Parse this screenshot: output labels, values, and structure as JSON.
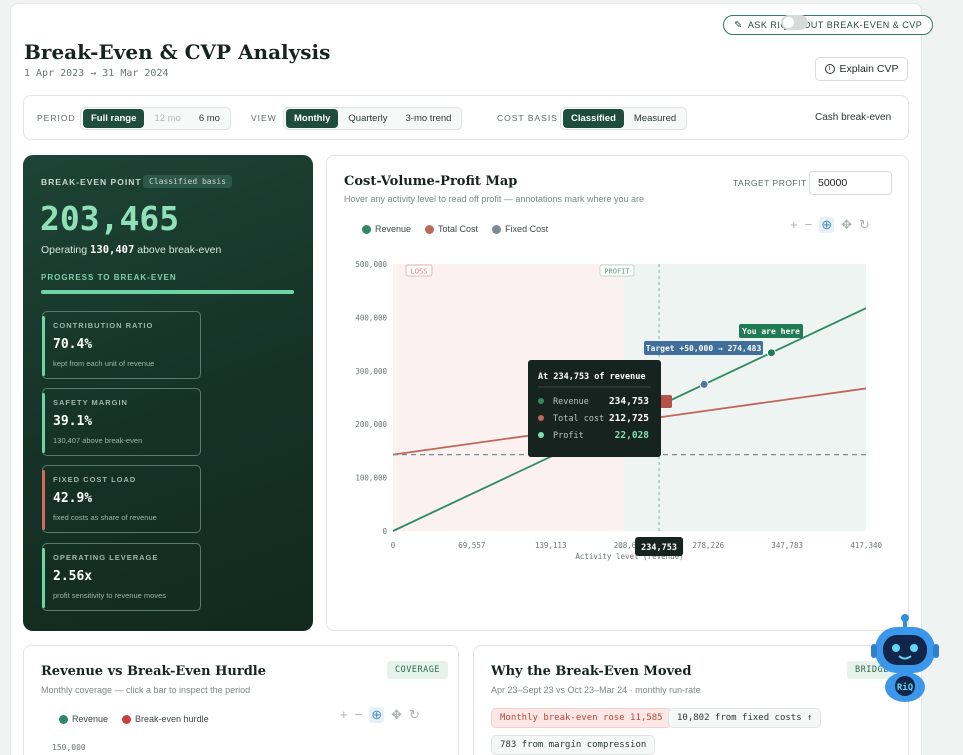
{
  "header": {
    "ask_button": "ASK RIQ ABOUT BREAK-EVEN & CVP",
    "title": "Break-Even & CVP Analysis",
    "date_range": "1 Apr 2023 → 31 Mar 2024",
    "explain_button": "Explain CVP"
  },
  "toolbar": {
    "period_label": "PERIOD",
    "period_options": [
      "Full range",
      "12 mo",
      "6 mo"
    ],
    "view_label": "VIEW",
    "view_options": [
      "Monthly",
      "Quarterly",
      "3-mo trend"
    ],
    "cost_basis_label": "COST BASIS",
    "cost_basis_options": [
      "Classified",
      "Measured"
    ],
    "cash_toggle_label": "Cash break-even",
    "cash_toggle_on": false
  },
  "bep": {
    "heading": "BREAK-EVEN POINT",
    "badge": "Classified basis",
    "value": "203,465",
    "sub_prefix": "Operating",
    "sub_value": "130,407",
    "sub_suffix": "above break-even",
    "progress_label": "PROGRESS TO BREAK-EVEN",
    "progress": 1.0,
    "metrics": [
      {
        "label": "CONTRIBUTION RATIO",
        "value": "70.4%",
        "desc": "kept from each unit of revenue",
        "accent": "#6fd4a2"
      },
      {
        "label": "SAFETY MARGIN",
        "value": "39.1%",
        "desc": "130,407 above break-even",
        "accent": "#6fd4a2"
      },
      {
        "label": "FIXED COST LOAD",
        "value": "42.9%",
        "desc": "fixed costs as share of revenue",
        "accent": "#d06a5d"
      },
      {
        "label": "OPERATING LEVERAGE",
        "value": "2.56x",
        "desc": "profit sensitivity to revenue moves",
        "accent": "#6fd4a2"
      }
    ]
  },
  "cvp": {
    "title": "Cost-Volume-Profit Map",
    "subtitle": "Hover any activity level to read off profit — annotations mark where you are",
    "target_profit_label": "TARGET PROFIT",
    "target_profit_value": "50000",
    "legend": [
      {
        "name": "Revenue",
        "color": "#2f8a63"
      },
      {
        "name": "Total Cost",
        "color": "#c0675a"
      },
      {
        "name": "Fixed Cost",
        "color": "#7c8b93"
      }
    ],
    "tools": [
      "zoom-in-icon",
      "zoom-out-icon",
      "zoom-select-icon",
      "pan-icon",
      "reset-icon"
    ]
  },
  "chart_data": {
    "type": "line",
    "xlabel": "Activity level (revenue)",
    "ylabel": "",
    "xlim": [
      0,
      417340
    ],
    "ylim": [
      0,
      500000
    ],
    "x_ticks": [
      "0",
      "69,557",
      "139,113",
      "208,670",
      "278,226",
      "347,783",
      "417,340"
    ],
    "y_ticks": [
      "0",
      "100,000",
      "200,000",
      "300,000",
      "400,000",
      "500,000"
    ],
    "series": [
      {
        "name": "Revenue",
        "points": [
          [
            0,
            0
          ],
          [
            417340,
            417340
          ]
        ],
        "color": "#2f8a63"
      },
      {
        "name": "Total Cost",
        "points": [
          [
            0,
            143000
          ],
          [
            417340,
            267000
          ]
        ],
        "color": "#c0675a"
      },
      {
        "name": "Fixed Cost",
        "points": [
          [
            0,
            143000
          ],
          [
            417340,
            143000
          ]
        ],
        "color": "#7c8b93"
      }
    ],
    "zones": [
      {
        "label": "LOSS"
      },
      {
        "label": "PROFIT"
      }
    ],
    "break_even_x": 203465,
    "hover_x": 234753,
    "hover_x_label": "234,753",
    "markers": [
      {
        "label": "Target +50,000 → 274,483",
        "x": 274483,
        "y": 274483
      },
      {
        "label": "You are here",
        "x": 333872,
        "y": 333872
      }
    ],
    "tooltip": {
      "title": "At 234,753 of revenue",
      "rows": [
        {
          "name": "Revenue",
          "value": "234,753",
          "color": "#2f8a63"
        },
        {
          "name": "Total cost",
          "value": "212,725",
          "color": "#c0675a"
        },
        {
          "name": "Profit",
          "value": "22,028",
          "color": "#7ee0b0"
        }
      ]
    },
    "grid": true
  },
  "revenue_card": {
    "title": "Revenue vs Break-Even Hurdle",
    "subtitle": "Monthly coverage — click a bar to inspect the period",
    "tag": "COVERAGE",
    "legend": [
      {
        "name": "Revenue",
        "color": "#2f8a63"
      },
      {
        "name": "Break-even hurdle",
        "color": "#c94040"
      }
    ],
    "y_top_tick": "150,000"
  },
  "why_card": {
    "title": "Why the Break-Even Moved",
    "subtitle": "Apr 23–Sept 23 vs Oct 23–Mar 24 · monthly run-rate",
    "tag": "BRIDGE",
    "pills": [
      "Monthly break-even rose 11,585",
      "10,802 from fixed costs ↑",
      "783 from margin compression"
    ]
  },
  "assistant": {
    "label": "RiQ"
  }
}
